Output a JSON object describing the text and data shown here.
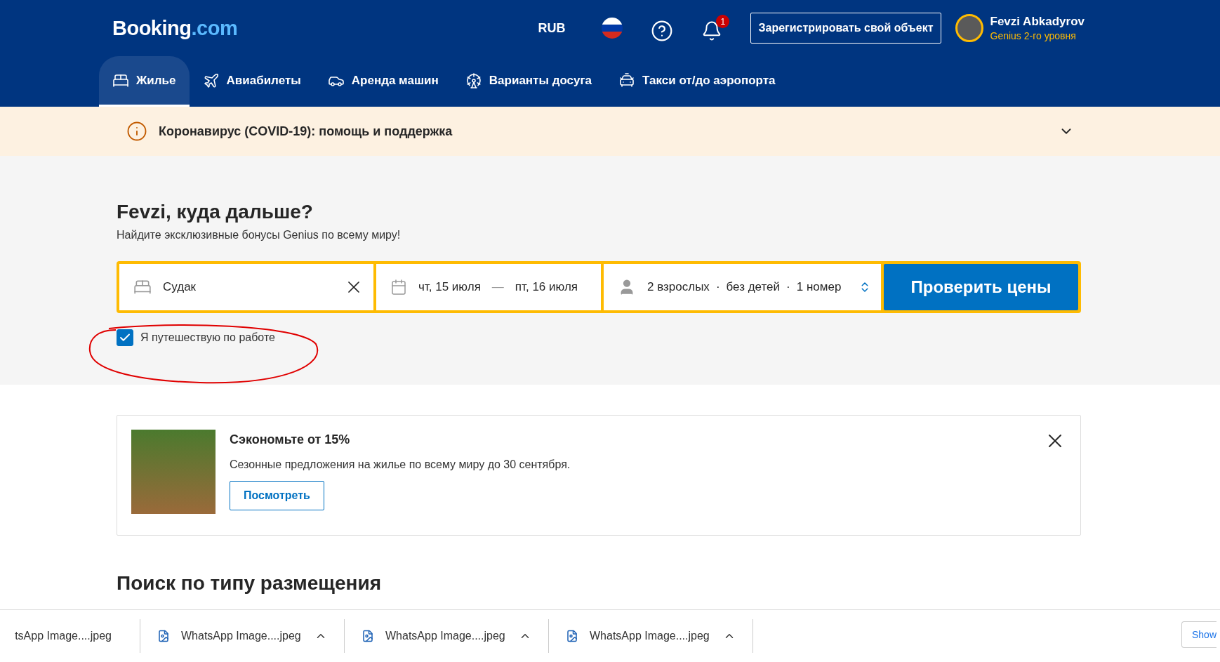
{
  "header": {
    "logo": {
      "main": "Booking",
      "suffix": ".com"
    },
    "currency": "RUB",
    "notification_count": "1",
    "register_button": "Зарегистрировать свой объект",
    "user": {
      "name": "Fevzi Abkadyrov",
      "level": "Genius 2-го уровня"
    }
  },
  "nav": [
    {
      "label": "Жилье",
      "kind": "stay",
      "selected": true
    },
    {
      "label": "Авиабилеты",
      "kind": "flight",
      "selected": false
    },
    {
      "label": "Аренда машин",
      "kind": "car",
      "selected": false
    },
    {
      "label": "Варианты досуга",
      "kind": "leisure",
      "selected": false
    },
    {
      "label": "Такси от/до аэропорта",
      "kind": "taxi",
      "selected": false
    }
  ],
  "covid_banner": {
    "text": "Коронавирус (COVID-19): помощь и поддержка"
  },
  "search": {
    "title": "Fevzi, куда дальше?",
    "subtitle": "Найдите эксклюзивные бонусы Genius по всему миру!",
    "destination": "Судак",
    "checkin": "чт, 15 июля",
    "date_separator": "—",
    "checkout": "пт, 16 июля",
    "guests": [
      "2 взрослых",
      "·",
      "без детей",
      "·",
      "1 номер"
    ],
    "submit": "Проверить цены",
    "business_trip": {
      "label": "Я путешествую по работе",
      "checked": true
    }
  },
  "promo": {
    "title": "Сэкономьте от 15%",
    "text": "Сезонные предложения на жилье по всему миру до 30 сентября.",
    "button": "Посмотреть"
  },
  "section_title": "Поиск по типу размещения",
  "downloads": {
    "items": [
      {
        "name": "tsApp Image....jpeg",
        "has_icon": false
      },
      {
        "name": "WhatsApp Image....jpeg",
        "has_icon": true
      },
      {
        "name": "WhatsApp Image....jpeg",
        "has_icon": true
      },
      {
        "name": "WhatsApp Image....jpeg",
        "has_icon": true
      }
    ],
    "show_button": "Show"
  }
}
